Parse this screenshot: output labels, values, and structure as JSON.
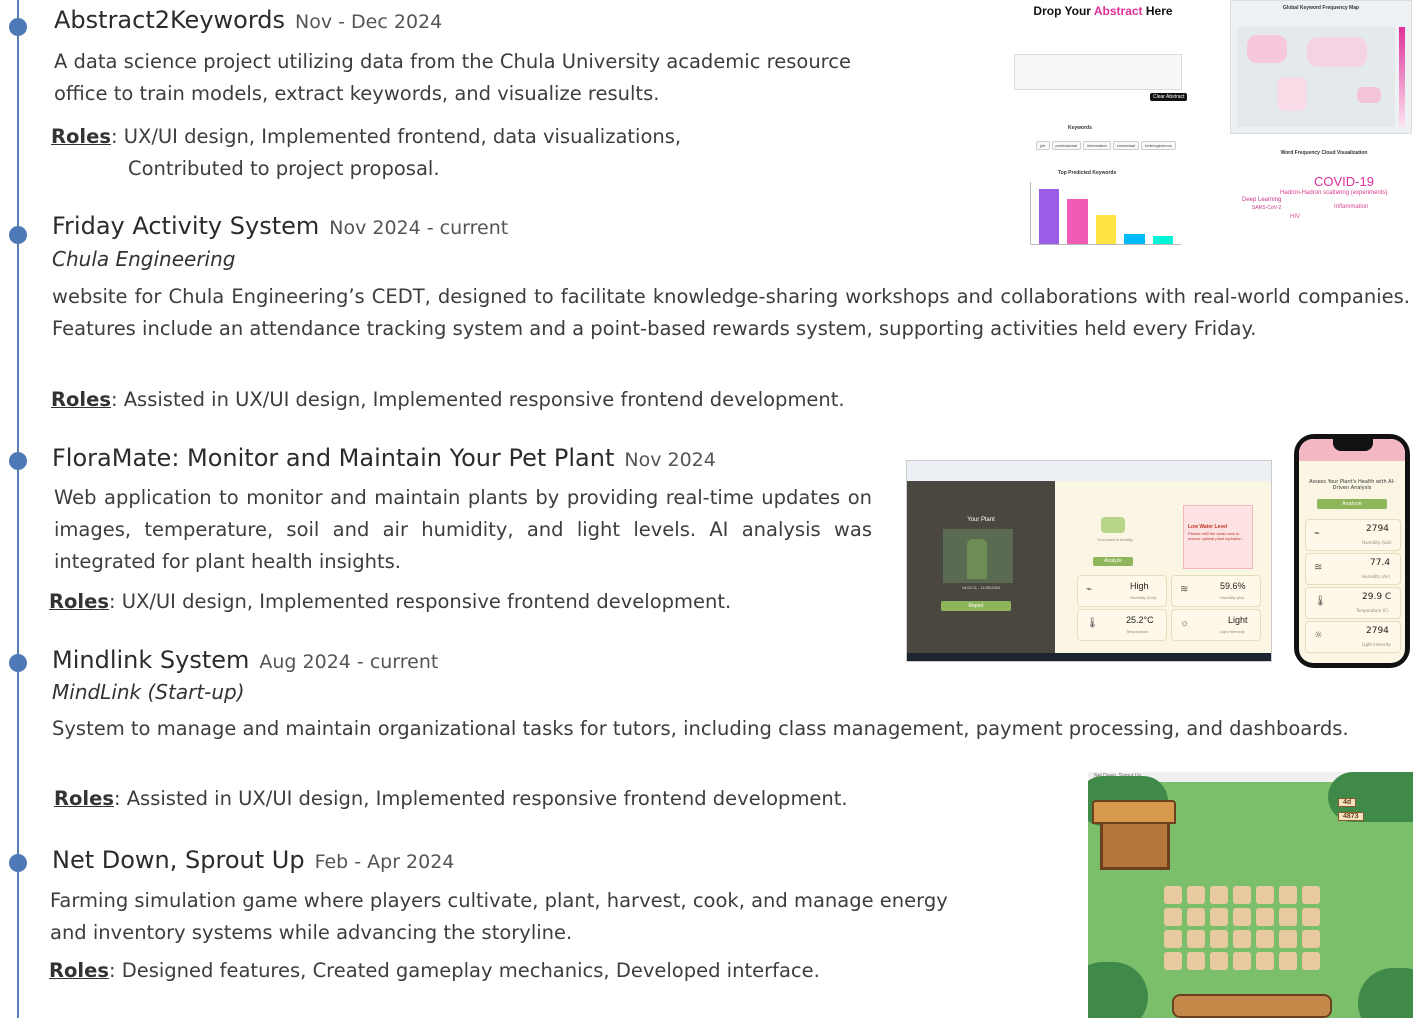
{
  "projects": [
    {
      "title": "Abstract2Keywords",
      "date": "Nov - Dec 2024",
      "desc": "A data science project utilizing data from the Chula University academic resource office to train models, extract keywords, and visualize results.",
      "roles_label": "Roles",
      "roles_line1": ": UX/UI design, Implemented frontend, data visualizations,",
      "roles_line2": "Contributed to project proposal."
    },
    {
      "title": "Friday Activity System",
      "date": "Nov 2024 - current",
      "org": "Chula Engineering",
      "desc": "website for Chula Engineering’s CEDT, designed to facilitate knowledge-sharing workshops and collaborations with real-world companies. Features include an attendance tracking system and a point-based rewards system, supporting activities held every Friday.",
      "roles_label": "Roles",
      "roles": ": Assisted in UX/UI design, Implemented responsive frontend development."
    },
    {
      "title": "FloraMate: Monitor and Maintain Your Pet Plant",
      "date": "Nov 2024",
      "desc": "Web application to monitor and maintain plants by providing real-time updates on images, temperature, soil and air humidity, and light levels. AI analysis was integrated for plant health insights.",
      "roles_label": "Roles",
      "roles": ": UX/UI design, Implemented responsive frontend development."
    },
    {
      "title": "Mindlink System",
      "date": "Aug 2024 - current",
      "org": "MindLink (Start-up)",
      "desc": "System to manage and maintain organizational tasks for tutors, including class management, payment processing, and dashboards.",
      "roles_label": "Roles",
      "roles": ": Assisted in UX/UI design, Implemented responsive frontend development."
    },
    {
      "title": "Net Down, Sprout Up",
      "date": "Feb - Apr 2024",
      "desc": "Farming simulation game where players cultivate, plant, harvest, cook, and manage energy and inventory systems while advancing the storyline.",
      "roles_label": "Roles",
      "roles": ": Designed features, Created gameplay mechanics, Developed interface."
    }
  ],
  "a2k_shot": {
    "title_pre": "Drop Your ",
    "title_accent": "Abstract",
    "title_post": " Here",
    "map_title": "Global Keyword Frequency Map",
    "keywords_title": "Keywords",
    "keywords": [
      "job",
      "professional",
      "information",
      "contextual",
      "heterogeneous"
    ],
    "bar_title": "Top Predicted Keywords",
    "bar_values": [
      0.4,
      0.33,
      0.21,
      0.07,
      0.06
    ],
    "bar_colors": [
      "#9b5de5",
      "#f15bb5",
      "#fee440",
      "#00bbf9",
      "#00f5d4"
    ],
    "cloud_title": "Word Frequency Cloud Visualization",
    "cloud_words": [
      "COVID-19",
      "Hadron-Hadron scattering (experiments)",
      "Deep Learning",
      "SARS-CoV-2",
      "Inflammation",
      "HIV"
    ],
    "clear_btn": "Clear Abstract"
  },
  "floramate_shot": {
    "side_title": "Your Plant",
    "timestamp": "16:02:11 - 11/30/2024",
    "side_btn": "Report",
    "status": "Your plant is healthy",
    "analyze_btn": "Analyze",
    "alert_title": "Low Water Level",
    "alert_text": "Please refill the water tank to ensure optimal plant hydration.",
    "humidity_soil": "High",
    "humidity_soil_label": "Humidity (Soil)",
    "humidity_air": "59.6%",
    "humidity_air_label": "Humidity (Air)",
    "temperature": "25.2°C",
    "temperature_label": "Temperature",
    "light": "Light",
    "light_label": "Light Intensity"
  },
  "phone_shot": {
    "heading": "Assess Your Plant's Health with AI-Driven Analysis",
    "analyze_btn": "Analyze",
    "rows": [
      {
        "value": "2794",
        "label": "Humidity (Soil)"
      },
      {
        "value": "77.4",
        "label": "Humidity (Air)"
      },
      {
        "value": "29.9 C",
        "label": "Temperature (C)"
      },
      {
        "value": "2794",
        "label": "Light Intensity"
      }
    ]
  },
  "game_shot": {
    "window_title": "Net Down, Sprout Up",
    "energy": "4d",
    "coins": "4873"
  }
}
